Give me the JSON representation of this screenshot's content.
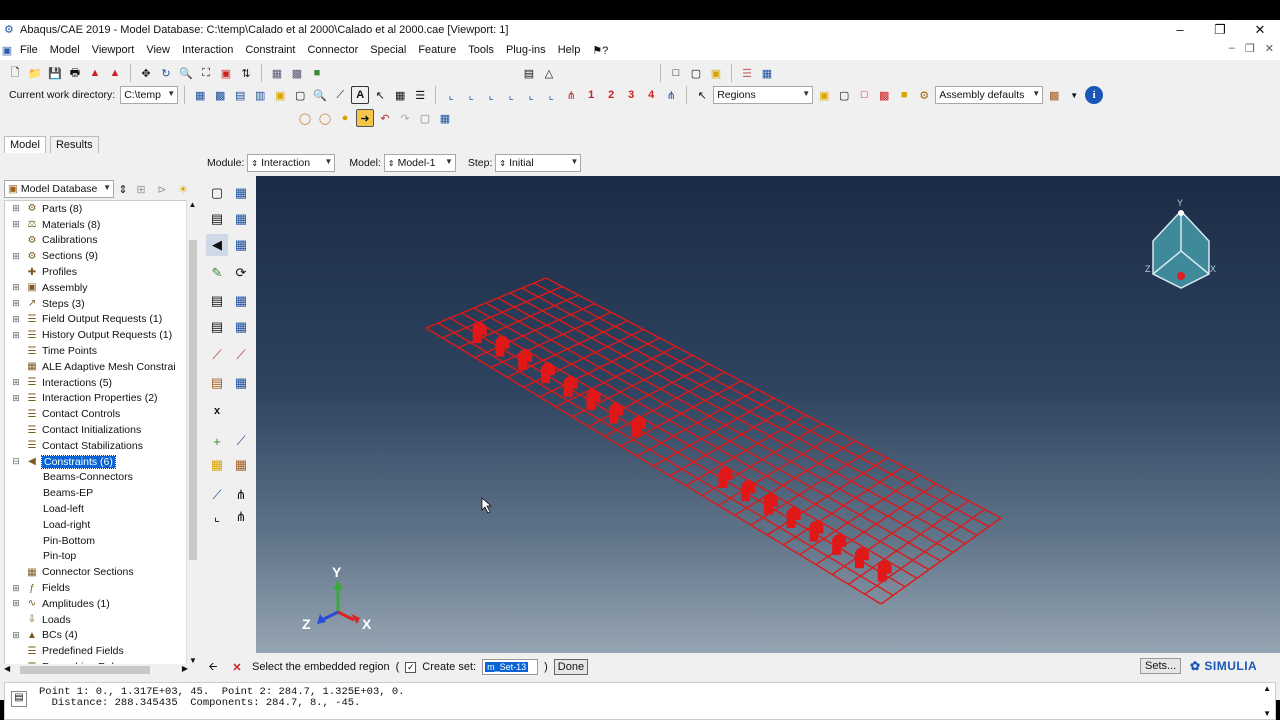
{
  "window": {
    "title": "Abaqus/CAE 2019 - Model Database: C:\\temp\\Calado et al 2000\\Calado et al 2000.cae [Viewport: 1]"
  },
  "menu": [
    "File",
    "Model",
    "Viewport",
    "View",
    "Interaction",
    "Constraint",
    "Connector",
    "Special",
    "Feature",
    "Tools",
    "Plug-ins",
    "Help",
    "⚑?"
  ],
  "toolbar": {
    "work_dir_label": "Current work directory:",
    "work_dir_value": "C:\\temp",
    "regions_value": "Regions",
    "assembly_value": "Assembly defaults",
    "numbers": [
      "1",
      "2",
      "3",
      "4"
    ]
  },
  "tabs": {
    "model": "Model",
    "results": "Results"
  },
  "tree_header": {
    "value": "Model Database"
  },
  "tree": [
    {
      "label": "Parts (8)",
      "pm": "⊞",
      "icon": "⚙"
    },
    {
      "label": "Materials (8)",
      "pm": "⊞",
      "icon": "⚖"
    },
    {
      "label": "Calibrations",
      "pm": "",
      "icon": "⚙"
    },
    {
      "label": "Sections (9)",
      "pm": "⊞",
      "icon": "⚙"
    },
    {
      "label": "Profiles",
      "pm": "",
      "icon": "✚"
    },
    {
      "label": "Assembly",
      "pm": "⊞",
      "icon": "▣"
    },
    {
      "label": "Steps (3)",
      "pm": "⊞",
      "icon": "↗"
    },
    {
      "label": "Field Output Requests (1)",
      "pm": "⊞",
      "icon": "☰"
    },
    {
      "label": "History Output Requests (1)",
      "pm": "⊞",
      "icon": "☰"
    },
    {
      "label": "Time Points",
      "pm": "",
      "icon": "☰"
    },
    {
      "label": "ALE Adaptive Mesh Constrai",
      "pm": "",
      "icon": "▦"
    },
    {
      "label": "Interactions (5)",
      "pm": "⊞",
      "icon": "☰"
    },
    {
      "label": "Interaction Properties (2)",
      "pm": "⊞",
      "icon": "☰"
    },
    {
      "label": "Contact Controls",
      "pm": "",
      "icon": "☰"
    },
    {
      "label": "Contact Initializations",
      "pm": "",
      "icon": "☰"
    },
    {
      "label": "Contact Stabilizations",
      "pm": "",
      "icon": "☰"
    },
    {
      "label": "Constraints (6)",
      "pm": "⊟",
      "icon": "◀",
      "selected": true
    },
    {
      "label": "Beams-Connectors",
      "pm": "",
      "icon": "",
      "indent": true
    },
    {
      "label": "Beams-EP",
      "pm": "",
      "icon": "",
      "indent": true
    },
    {
      "label": "Load-left",
      "pm": "",
      "icon": "",
      "indent": true
    },
    {
      "label": "Load-right",
      "pm": "",
      "icon": "",
      "indent": true
    },
    {
      "label": "Pin-Bottom",
      "pm": "",
      "icon": "",
      "indent": true
    },
    {
      "label": "Pin-top",
      "pm": "",
      "icon": "",
      "indent": true
    },
    {
      "label": "Connector Sections",
      "pm": "",
      "icon": "▦"
    },
    {
      "label": "Fields",
      "pm": "⊞",
      "icon": "ƒ"
    },
    {
      "label": "Amplitudes (1)",
      "pm": "⊞",
      "icon": "∿"
    },
    {
      "label": "Loads",
      "pm": "",
      "icon": "⇩"
    },
    {
      "label": "BCs (4)",
      "pm": "⊞",
      "icon": "▲"
    },
    {
      "label": "Predefined Fields",
      "pm": "",
      "icon": "☰"
    },
    {
      "label": "Remeshing Rules",
      "pm": "",
      "icon": "☰"
    }
  ],
  "context": {
    "module_label": "Module:",
    "module_value": "Interaction",
    "model_label": "Model:",
    "model_value": "Model-1",
    "step_label": "Step:",
    "step_value": "Initial"
  },
  "viewport": {
    "triad": {
      "y": "Y",
      "z": "Z",
      "x": "X"
    },
    "mesh_color": "#e01818",
    "background_top": "#1b2b45",
    "background_bottom": "#96a5b2"
  },
  "prompt": {
    "text": "Select the embedded region",
    "open_paren": "(",
    "create_set_label": "Create set:",
    "set_name": "m_Set-13",
    "close_paren": ")",
    "done_label": "Done",
    "sets_label": "Sets...",
    "brand": "SIMULIA"
  },
  "message": {
    "line1": "Point 1: 0., 1.317E+03, 45.  Point 2: 284.7, 1.325E+03, 0.",
    "line2": "  Distance: 288.345435  Components: 284.7, 8., -45."
  }
}
